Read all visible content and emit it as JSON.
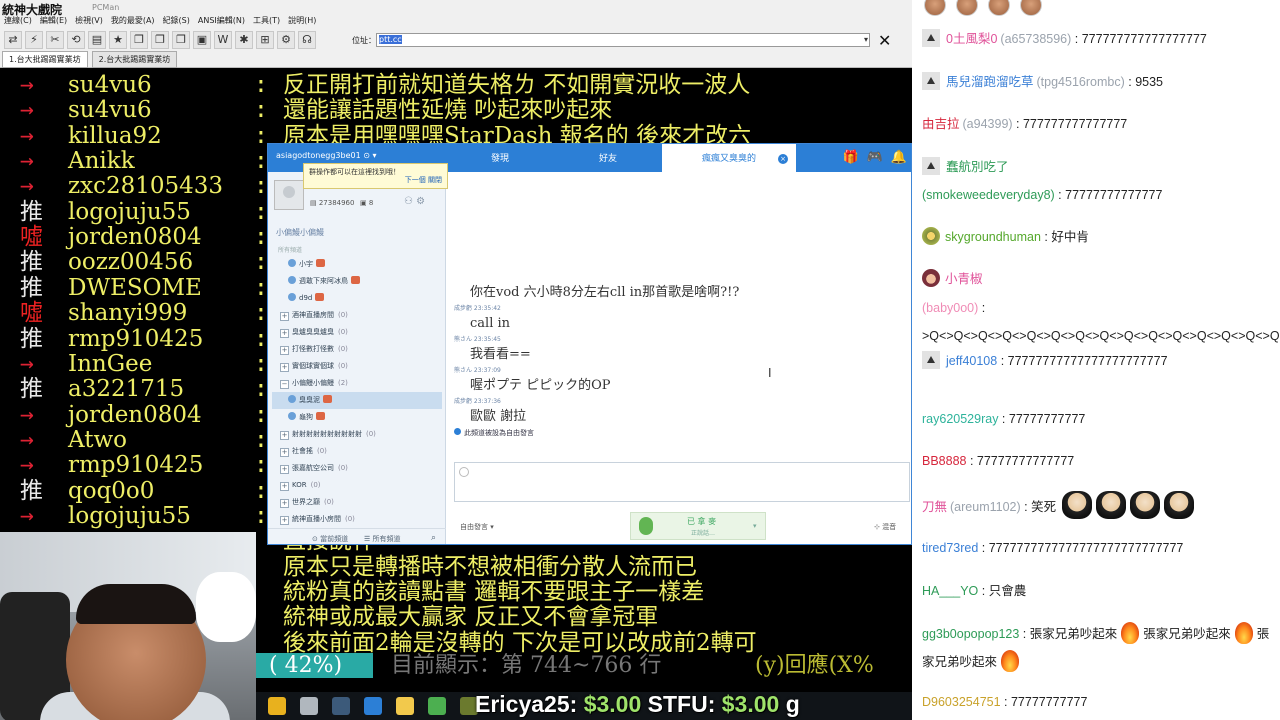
{
  "pcman": {
    "logo": "統神大戲院",
    "logo_sub": "PCMan",
    "menu": [
      "連線(C)",
      "編輯(E)",
      "檢視(V)",
      "我的最愛(A)",
      "紀錄(S)",
      "ANSI編輯(N)",
      "工具(T)",
      "說明(H)"
    ],
    "toolbar_icons": [
      "connect-icon",
      "disconnect-icon",
      "reconnect-icon",
      "reconnect-all-icon",
      "ansi-icon",
      "favorite-icon",
      "copy-icon",
      "paste-icon",
      "copy-all-icon",
      "save-icon",
      "wiki-icon",
      "gear-icon",
      "window-icon",
      "settings-icon",
      "pcman-icon"
    ],
    "toolbar_glyphs": [
      "⇄",
      "⚡",
      "✂",
      "⟲",
      "▤",
      "★",
      "❐",
      "❐",
      "❐",
      "▣",
      "W",
      "✱",
      "⊞",
      "⚙",
      "☊"
    ],
    "address_label": "位址：",
    "address_value": "ptt.cc",
    "close_glyph": "✕",
    "tabs": [
      "1.台大批踢踢實業坊",
      "2.台大批踢踢實業坊"
    ],
    "bbs_rows": [
      {
        "tag": "→",
        "kind": "arrow",
        "user": "su4vu6",
        "text": "反正開打前就知道失格ㄌ  不如開實況收一波人"
      },
      {
        "tag": "→",
        "kind": "arrow",
        "user": "su4vu6",
        "text": "還能讓話題性延燒  吵起來吵起來"
      },
      {
        "tag": "→",
        "kind": "arrow",
        "user": "killua92",
        "text": "原本是用嘿嘿嘿StarDash  報名的  後來才改六"
      },
      {
        "tag": "→",
        "kind": "arrow",
        "user": "Anikk",
        "text": ""
      },
      {
        "tag": "→",
        "kind": "arrow",
        "user": "zxc28105433",
        "text": ""
      },
      {
        "tag": "推",
        "kind": "push",
        "user": "logojuju55",
        "text": ""
      },
      {
        "tag": "噓",
        "kind": "boo",
        "user": "jorden0804",
        "text": ""
      },
      {
        "tag": "推",
        "kind": "push",
        "user": "oozz00456",
        "text": ""
      },
      {
        "tag": "推",
        "kind": "push",
        "user": "DWESOME",
        "text": ""
      },
      {
        "tag": "噓",
        "kind": "boo",
        "user": "shanyi999",
        "text": ""
      },
      {
        "tag": "推",
        "kind": "push",
        "user": "rmp910425",
        "text": ""
      },
      {
        "tag": "→",
        "kind": "arrow",
        "user": "InnGee",
        "text": ""
      },
      {
        "tag": "推",
        "kind": "push",
        "user": "a3221715",
        "text": ""
      },
      {
        "tag": "→",
        "kind": "arrow",
        "user": "jorden0804",
        "text": ""
      },
      {
        "tag": "→",
        "kind": "arrow",
        "user": "Atwo",
        "text": ""
      },
      {
        "tag": "→",
        "kind": "arrow",
        "user": "rmp910425",
        "text": ""
      },
      {
        "tag": "推",
        "kind": "push",
        "user": "qoq0o0",
        "text": ""
      },
      {
        "tag": "→",
        "kind": "arrow",
        "user": "logojuju55",
        "text": ""
      },
      {
        "tag": "",
        "kind": "arrow",
        "user": "",
        "text": "直接說什"
      },
      {
        "tag": "",
        "kind": "arrow",
        "user": "",
        "text": "原本只是轉播時不想被相衝分散人流而已"
      },
      {
        "tag": "",
        "kind": "arrow",
        "user": "",
        "text": "統粉真的該讀點書  邏輯不要跟主子一樣差"
      },
      {
        "tag": "",
        "kind": "arrow",
        "user": "",
        "text": "統神或成最大贏家  反正又不會拿冠軍"
      },
      {
        "tag": "",
        "kind": "arrow",
        "user": "",
        "text": "後來前面2輪是沒轉的  下次是可以改成前2轉可"
      }
    ],
    "status": {
      "percent": "( 42%)",
      "text": "目前顯示：第 744~766 行",
      "reply": "(y)回應(X%"
    }
  },
  "donations": [
    {
      "name": "Ericya25:",
      "amount": "$3.00"
    },
    {
      "name": "STFU:",
      "amount": "$3.00"
    }
  ],
  "donation_tail": "g",
  "taskbar": {
    "icons": [
      "chrome-icon",
      "cursor-icon",
      "steam-icon",
      "pcman-icon",
      "folder-icon",
      "voice-app-icon",
      "terminal-icon"
    ],
    "colors": [
      "#e8b11e",
      "#b0b7be",
      "#3c5a7a",
      "#2c7fd6",
      "#f2c94c",
      "#4caf50",
      "#6b7a2e"
    ]
  },
  "voice_app": {
    "account": "asiagodtonegg3be01 ⊙ ▾",
    "tabs": [
      "發現",
      "好友",
      "瘋瘋又臭臭的"
    ],
    "active_tab": 2,
    "tab_close": "×",
    "header_icons": [
      "gift-icon",
      "gamepad-icon",
      "bell-icon"
    ],
    "header_glyphs": [
      "🎁",
      "🎮",
      "🔔"
    ],
    "tooltip": "群操作都可以在這裡找到哦！",
    "tooltip_links": "下一個  關閉",
    "user_id": "▤ 27384960",
    "level": "▣ 8",
    "user_icons": "⚇ ⚙",
    "channel_title": "小偏鰻小偏鰻",
    "channel_sub": "所有頻道",
    "tree": [
      {
        "label": "小宇",
        "count": "",
        "kind": "user",
        "icon": "m",
        "badge": true
      },
      {
        "label": "週敢下來阿冰鳥",
        "count": "",
        "kind": "user",
        "icon": "m",
        "badge": true
      },
      {
        "label": "d9d",
        "count": "",
        "kind": "user",
        "icon": "m",
        "badge": true
      },
      {
        "label": "酒神直播房間",
        "count": "(0)",
        "kind": "room",
        "icon": "",
        "badge": false
      },
      {
        "label": "臭爐臭臭爐臭",
        "count": "(0)",
        "kind": "room",
        "icon": "",
        "badge": false
      },
      {
        "label": "打怪數打怪數",
        "count": "(0)",
        "kind": "room",
        "icon": "",
        "badge": false
      },
      {
        "label": "實個球實個球",
        "count": "(0)",
        "kind": "room",
        "icon": "",
        "badge": false
      },
      {
        "label": "小偏鰻小偏鰻",
        "count": "(2)",
        "kind": "room",
        "icon": "",
        "badge": false,
        "expanded": true
      },
      {
        "label": "臭臭泥",
        "count": "",
        "kind": "user",
        "icon": "m",
        "badge": true,
        "selected": true
      },
      {
        "label": "龜狗",
        "count": "",
        "kind": "user",
        "icon": "m",
        "badge": true
      },
      {
        "label": "射射射射射射射射射射",
        "count": "(0)",
        "kind": "room",
        "icon": "",
        "badge": false
      },
      {
        "label": "社會搖",
        "count": "(0)",
        "kind": "room",
        "icon": "",
        "badge": false
      },
      {
        "label": "張嘉航空公司",
        "count": "(0)",
        "kind": "room",
        "icon": "",
        "badge": false
      },
      {
        "label": "KOR",
        "count": "(0)",
        "kind": "room",
        "icon": "",
        "badge": false
      },
      {
        "label": "世界之巔",
        "count": "(0)",
        "kind": "room",
        "icon": "",
        "badge": false
      },
      {
        "label": "統神直播小房間",
        "count": "(0)",
        "kind": "room",
        "icon": "",
        "badge": false
      }
    ],
    "left_footer": {
      "current": "⊙ 當前頻道",
      "all": "☰ 所有頻道",
      "search": "⌕"
    },
    "messages": [
      {
        "meta": "",
        "text": "你在vod 六小時8分左右cll in那首歌是啥啊?!?"
      },
      {
        "meta": "成步虧 23:35:42",
        "text": "call in"
      },
      {
        "meta": "熊さん 23:35:45",
        "text": "我看看=="
      },
      {
        "meta": "熊さん 23:37:09",
        "text": "喔ポプテ ピピック的OP"
      },
      {
        "meta": "成步虧 23:37:36",
        "text": "歐歐 謝拉"
      }
    ],
    "system_note": "此頻道被設為自由發言",
    "cursor": "I",
    "mode": "自由發言 ▾",
    "mic_label": "已 拿 麥",
    "mic_sub": "正說話…",
    "mic_drop": "▾",
    "mix": "⊹ 混音"
  },
  "chat": {
    "messages": [
      {
        "mod": true,
        "name": "0土風梨0",
        "login": "(a65738596)",
        "text": "777777777777777777",
        "color": "#e05299"
      },
      {
        "mod": true,
        "name": "馬兒溜跑溜吃草",
        "login": "(tpg4516rombc)",
        "text": "9535",
        "color": "#3a7fd6"
      },
      {
        "mod": false,
        "name": "由吉拉",
        "login": "(a94399)",
        "text": "777777777777777",
        "color": "#d6263c"
      },
      {
        "mod": true,
        "name": "蠢航別吃了",
        "login": "",
        "text": "",
        "color": "#2e9b57"
      },
      {
        "mod": false,
        "name": "",
        "login": "(smokeweedeveryday8)",
        "text": "77777777777777",
        "color": "#2e9b57"
      },
      {
        "mod": false,
        "name": "skygroundhuman",
        "login": "",
        "text": "好中肯",
        "color": "#55a82c",
        "badge": "egg"
      },
      {
        "mod": false,
        "name": "小青椒",
        "login": "",
        "text": "",
        "color": "#e05299",
        "badge": "girl"
      },
      {
        "mod": false,
        "name": "",
        "login": "(baby0o0)",
        "text": ">Q<>Q<>Q<>Q<>Q<>Q<>Q<>Q<>Q<>Q<>Q<>Q<>Q<>Q<>Q<>Q<",
        "color": "#f08cb6"
      },
      {
        "mod": true,
        "name": "jeff40108",
        "login": "",
        "text": "77777777777777777777777",
        "color": "#3a7fd6"
      },
      {
        "mod": false,
        "name": "ray620529ray",
        "login": "",
        "text": "77777777777",
        "color": "#2eb39b"
      },
      {
        "mod": false,
        "name": "BB8888",
        "login": "",
        "text": "77777777777777",
        "color": "#d6263c"
      },
      {
        "mod": false,
        "name": "刀無",
        "login": "(areum1102)",
        "text": "笑死",
        "color": "#e05299",
        "screams": 4
      },
      {
        "mod": false,
        "name": "tired73red",
        "login": "",
        "text": "7777777777777777777777777777",
        "color": "#3a7fd6"
      },
      {
        "mod": false,
        "name": "HA___YO",
        "login": "",
        "text": "只會農",
        "color": "#2e9b57"
      },
      {
        "mod": false,
        "name": "gg3b0opopop123",
        "login": "",
        "text": "張家兄弟吵起來  🔥  張家兄弟吵起來  🔥  張家兄弟吵起來  🔥",
        "color": "#2e9b57"
      },
      {
        "mod": false,
        "name": "D9603254751",
        "login": "",
        "text": "77777777777",
        "color": "#c9a22b"
      }
    ]
  }
}
